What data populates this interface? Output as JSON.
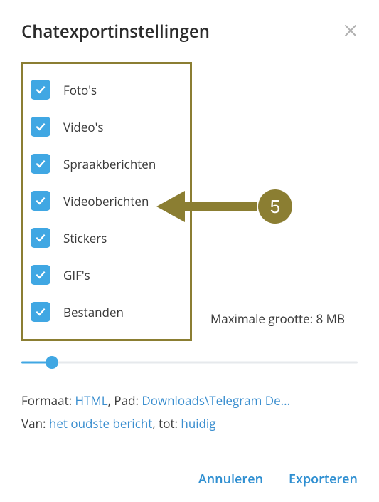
{
  "title": "Chatexportinstellingen",
  "options": [
    {
      "label": "Foto's",
      "checked": true
    },
    {
      "label": "Video's",
      "checked": true
    },
    {
      "label": "Spraakberichten",
      "checked": true
    },
    {
      "label": "Videoberichten",
      "checked": true
    },
    {
      "label": "Stickers",
      "checked": true
    },
    {
      "label": "GIF's",
      "checked": true
    },
    {
      "label": "Bestanden",
      "checked": true
    }
  ],
  "max_size_label": "Maximale grootte: 8 MB",
  "slider_percent": 9,
  "info": {
    "format_prefix": "Formaat: ",
    "format_value": "HTML",
    "path_prefix": ", Pad: ",
    "path_value": "Downloads\\Telegram De...",
    "from_prefix": "Van: ",
    "from_value": "het oudste bericht",
    "to_prefix": ", tot: ",
    "to_value": "huidig"
  },
  "buttons": {
    "cancel": "Annuleren",
    "export": "Exporteren"
  },
  "annotation": {
    "number": "5",
    "color": "#8b7e32"
  }
}
